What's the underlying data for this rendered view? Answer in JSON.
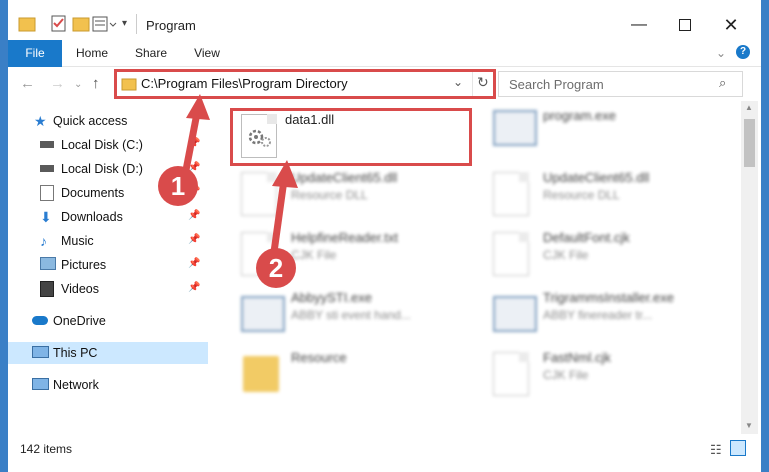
{
  "window": {
    "title": "Program",
    "minimize_icon": "minimize-icon",
    "maximize_icon": "maximize-icon",
    "close_icon": "close-icon"
  },
  "ribbon": {
    "tabs": [
      {
        "label": "File"
      },
      {
        "label": "Home"
      },
      {
        "label": "Share"
      },
      {
        "label": "View"
      }
    ]
  },
  "address": {
    "path": "C:\\Program Files\\Program Directory",
    "search_placeholder": "Search Program"
  },
  "nav": {
    "items": [
      {
        "label": "Quick access",
        "icon": "star-icon"
      },
      {
        "label": "Local Disk (C:)",
        "icon": "drive-icon"
      },
      {
        "label": "Local Disk (D:)",
        "icon": "drive-icon"
      },
      {
        "label": "Documents",
        "icon": "documents-icon"
      },
      {
        "label": "Downloads",
        "icon": "downloads-icon"
      },
      {
        "label": "Music",
        "icon": "music-icon"
      },
      {
        "label": "Pictures",
        "icon": "pictures-icon"
      },
      {
        "label": "Videos",
        "icon": "videos-icon"
      },
      {
        "label": "OneDrive",
        "icon": "cloud-icon"
      },
      {
        "label": "This PC",
        "icon": "pc-icon"
      },
      {
        "label": "Network",
        "icon": "network-icon"
      }
    ]
  },
  "files": [
    {
      "name": "data1.dll",
      "sub": ""
    },
    {
      "name": "program.exe",
      "sub": ""
    },
    {
      "name": "UpdateClient65.dll",
      "sub": "Resource DLL"
    },
    {
      "name": "UpdateClient65.dll",
      "sub": "Resource DLL"
    },
    {
      "name": "HelpfineReader.txt",
      "sub": "CJK File"
    },
    {
      "name": "DefaultFont.cjk",
      "sub": "CJK File"
    },
    {
      "name": "AbbyySTI.exe",
      "sub": "ABBY sti event hand..."
    },
    {
      "name": "TrigrammsInstaller.exe",
      "sub": "ABBY finereader tr..."
    },
    {
      "name": "Resource",
      "sub": ""
    },
    {
      "name": "FastNml.cjk",
      "sub": "CJK File"
    }
  ],
  "status": {
    "count": "142 items"
  },
  "markers": {
    "one": "1",
    "two": "2"
  },
  "colors": {
    "accent": "#1979ca",
    "highlight": "#d94b4b",
    "selection": "#cce8ff"
  }
}
